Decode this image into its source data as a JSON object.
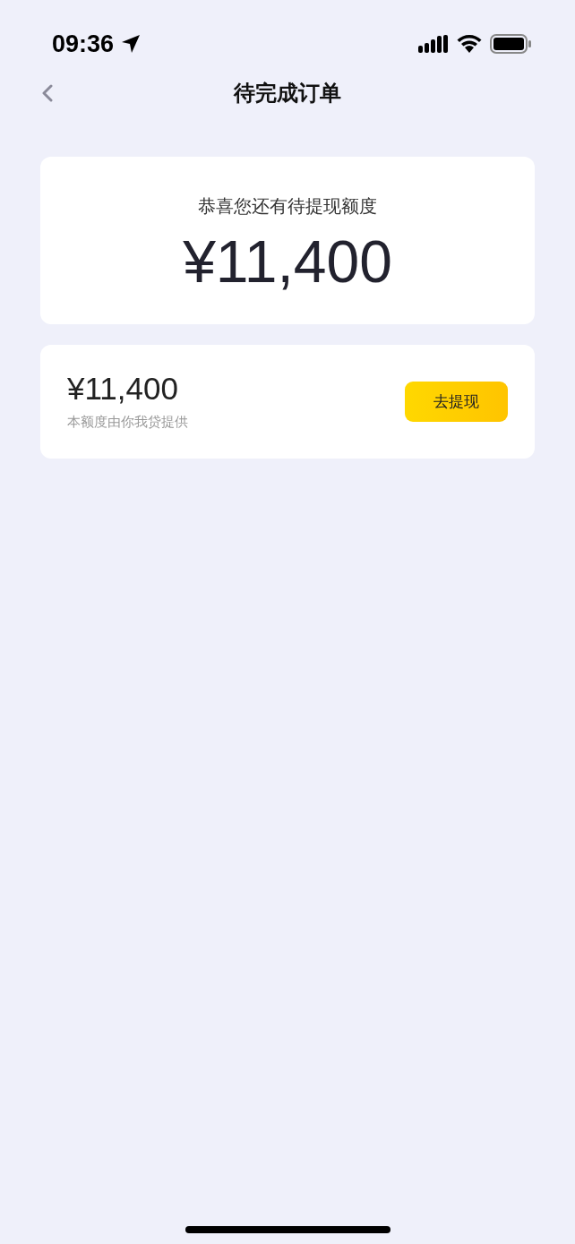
{
  "status_bar": {
    "time": "09:36"
  },
  "nav": {
    "title": "待完成订单"
  },
  "summary": {
    "caption": "恭喜您还有待提现额度",
    "amount": "¥11,400"
  },
  "offer": {
    "amount": "¥11,400",
    "note": "本额度由你我贷提供",
    "button": "去提现"
  }
}
